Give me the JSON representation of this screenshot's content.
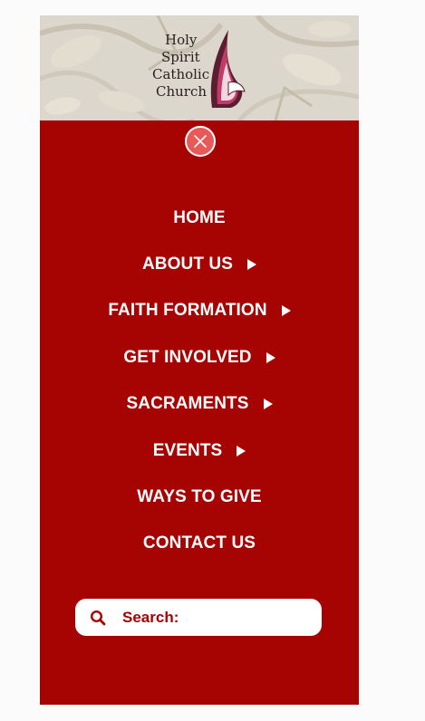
{
  "logo": {
    "lines": [
      "Holy",
      "Spirit",
      "Catholic",
      "Church"
    ]
  },
  "nav": {
    "items": [
      {
        "label": "HOME",
        "has_submenu": false
      },
      {
        "label": "ABOUT US",
        "has_submenu": true
      },
      {
        "label": "FAITH FORMATION",
        "has_submenu": true
      },
      {
        "label": "GET INVOLVED",
        "has_submenu": true
      },
      {
        "label": "SACRAMENTS",
        "has_submenu": true
      },
      {
        "label": "EVENTS",
        "has_submenu": true
      },
      {
        "label": "WAYS TO GIVE",
        "has_submenu": false
      },
      {
        "label": "CONTACT US",
        "has_submenu": false
      }
    ]
  },
  "search": {
    "placeholder": "Search:",
    "icon": "search-icon"
  },
  "close": {
    "icon": "close-icon"
  },
  "colors": {
    "menu_background": "#a60303",
    "page_background": "#fbfbfb",
    "close_fill": "#e65a5a",
    "text": "#ffffff"
  }
}
